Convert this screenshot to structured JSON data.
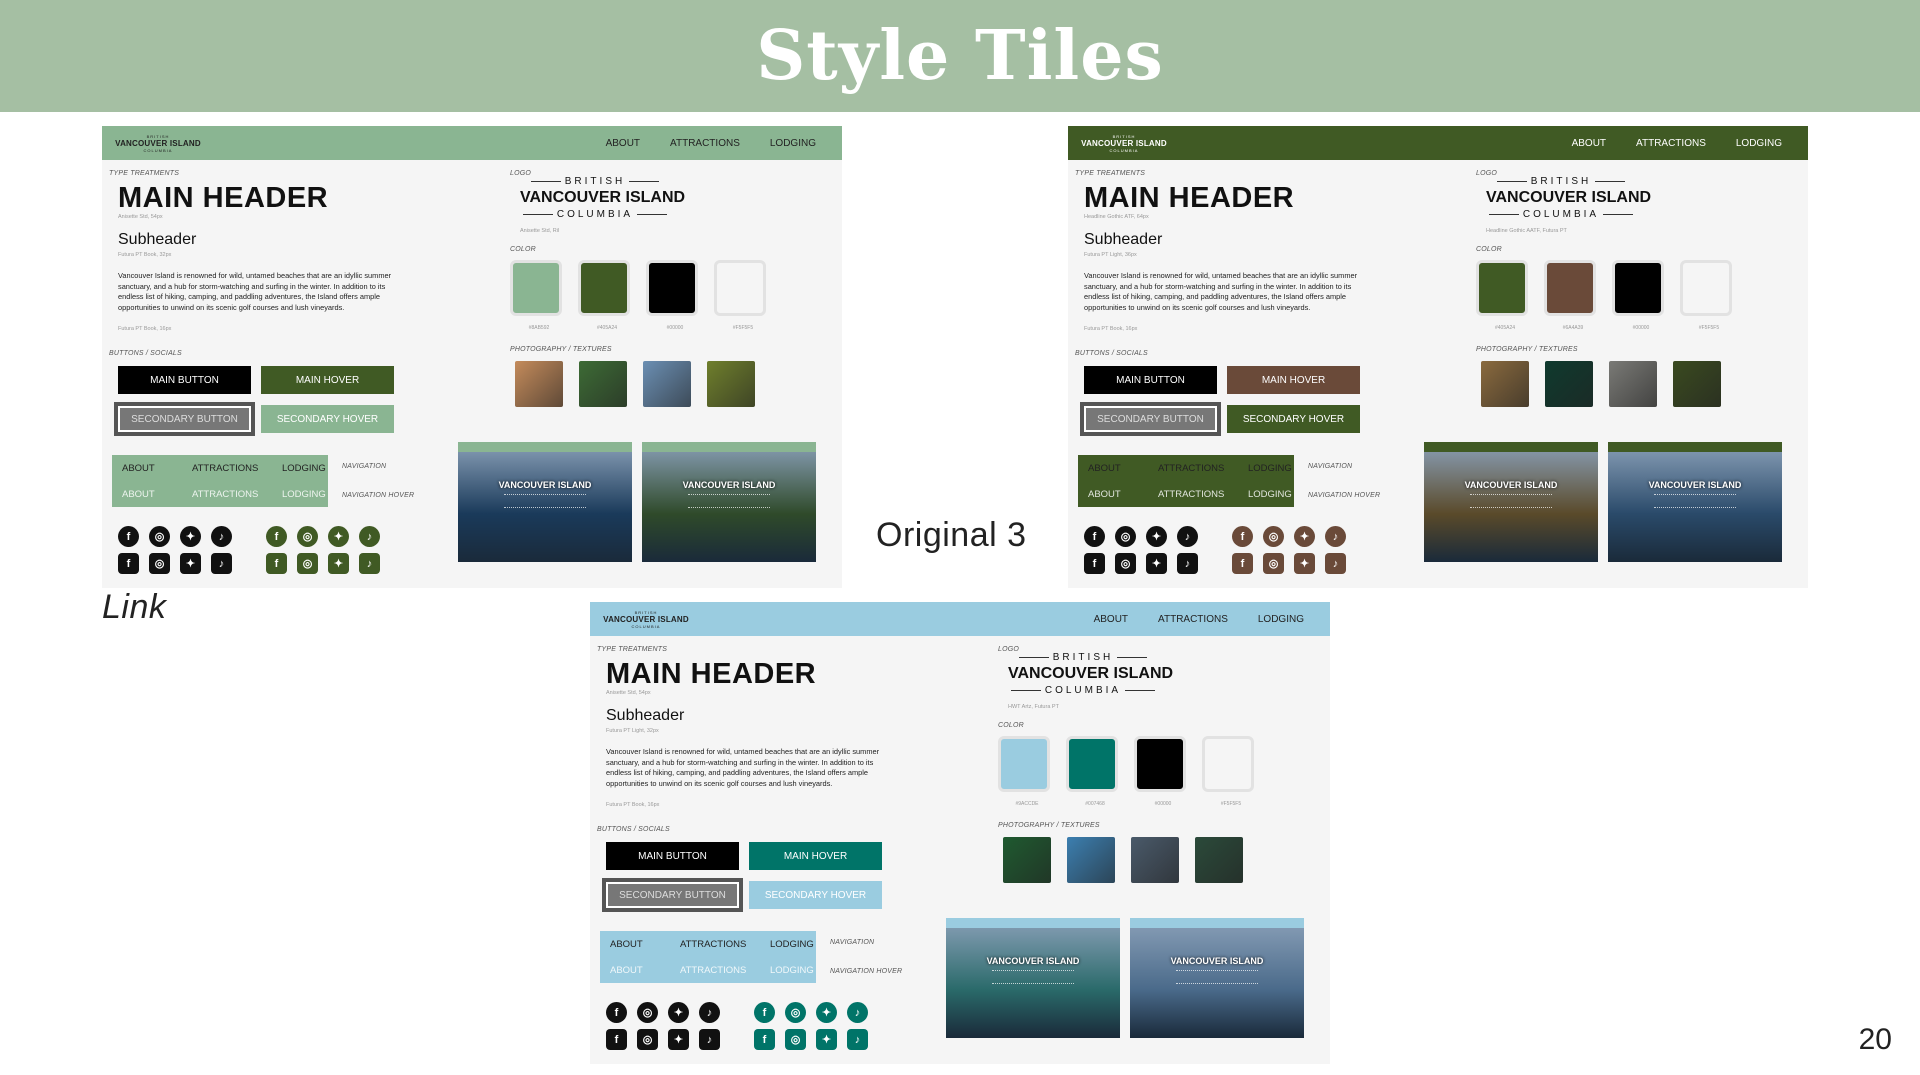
{
  "slide": {
    "title": "Style Tiles",
    "labels": {
      "link": "Link",
      "original": "Original 3"
    },
    "page_number": "20"
  },
  "common": {
    "logo_top": "BRITISH",
    "logo_mid": "VANCOUVER ISLAND",
    "logo_bot": "COLUMBIA",
    "nav": [
      "ABOUT",
      "ATTRACTIONS",
      "LODGING"
    ],
    "type_label": "TYPE TREATMENTS",
    "main_header": "MAIN HEADER",
    "subheader": "Subheader",
    "body_text": "Vancouver Island is renowned for wild, untamed beaches that are an idyllic summer sanctuary, and a hub for storm-watching and surfing in the winter. In addition to its endless list of hiking, camping, and paddling adventures, the Island offers ample opportunities to unwind on its scenic golf courses and lush vineyards.",
    "body_caption": "Futura PT Book, 16px",
    "buttons_label": "BUTTONS / SOCIALS",
    "btn_main": "MAIN BUTTON",
    "btn_hover": "MAIN HOVER",
    "btn_secondary": "SECONDARY BUTTON",
    "btn_secondary_hover": "SECONDARY HOVER",
    "navigation": "NAVIGATION",
    "navigation_hover": "NAVIGATION HOVER",
    "logo_label": "LOGO",
    "color_label": "COLOR",
    "photo_label": "PHOTOGRAPHY / TEXTURES",
    "shot_title": "VANCOUVER ISLAND"
  },
  "tiles": [
    {
      "name": "link",
      "nav_color": "#8ab592",
      "nav_text": "#222222",
      "header_caption": "Anisette Std, 54px",
      "sub_caption": "Futura PT Book, 32px",
      "logo_caption": "Anisette Std, Ril",
      "accent": "#405a24",
      "accent2": "#8ab592",
      "nav_demo_color": "#8ab592",
      "social_color_2": "#405a24",
      "swatches": [
        {
          "color": "#8ab592",
          "hex": "#8AB592"
        },
        {
          "color": "#405a24",
          "hex": "#405A24"
        },
        {
          "color": "#000000",
          "hex": "#00000"
        },
        {
          "color": "#f5f5f5",
          "hex": "#F5F5F5"
        }
      ],
      "photos": [
        "#c48b5b",
        "#3d6b35",
        "#6b8fb3",
        "#6f7f2c"
      ]
    },
    {
      "name": "original",
      "nav_color": "#405a24",
      "nav_text": "#ffffff",
      "header_caption": "Headline Gothic ATF, 64px",
      "sub_caption": "Futura PT Light, 36px",
      "logo_caption": "Headline Gothic AATF, Futura PT",
      "accent": "#6a4a39",
      "accent2": "#405a24",
      "nav_demo_color": "#405a24",
      "social_color_2": "#6a4a39",
      "swatches": [
        {
          "color": "#405a24",
          "hex": "#405A24"
        },
        {
          "color": "#6a4a39",
          "hex": "#6A4A39"
        },
        {
          "color": "#000000",
          "hex": "#00000"
        },
        {
          "color": "#f5f5f5",
          "hex": "#F5F5F5"
        }
      ],
      "photos": [
        "#8a6a3e",
        "#0f3a2e",
        "#7a7a76",
        "#3a4a20"
      ]
    },
    {
      "name": "blue",
      "nav_color": "#9acce0",
      "nav_text": "#222222",
      "header_caption": "Anisette Std, 54px",
      "sub_caption": "Futura PT Light, 32px",
      "logo_caption": "HWT Artz, Futura PT",
      "accent": "#007468",
      "accent2": "#9acce0",
      "nav_demo_color": "#9acce0",
      "social_color_2": "#007468",
      "swatches": [
        {
          "color": "#9acce0",
          "hex": "#9ACCDE"
        },
        {
          "color": "#007468",
          "hex": "#007468"
        },
        {
          "color": "#000000",
          "hex": "#00000"
        },
        {
          "color": "#f5f5f5",
          "hex": "#F5F5F5"
        }
      ],
      "photos": [
        "#1f5a30",
        "#3c7fb0",
        "#4a5a6a",
        "#2b4a3a"
      ]
    }
  ]
}
